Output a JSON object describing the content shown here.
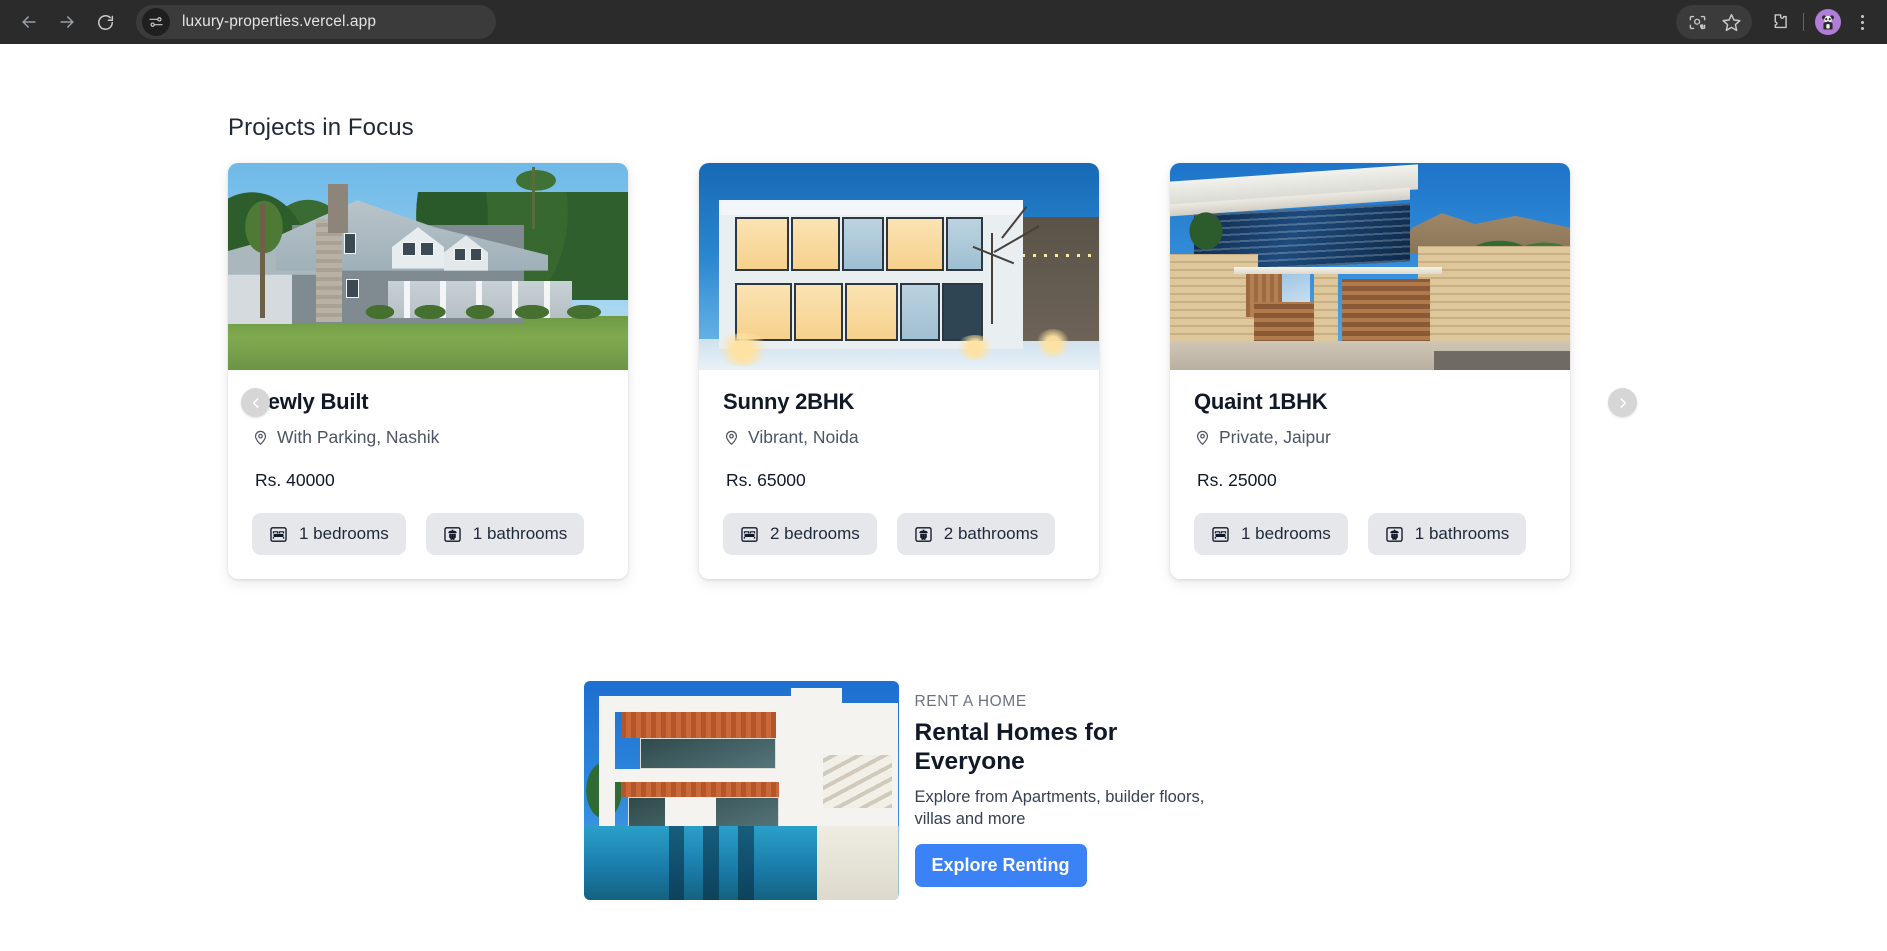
{
  "browser": {
    "url": "luxury-properties.vercel.app",
    "back_label": "Back",
    "forward_label": "Forward",
    "reload_label": "Reload",
    "site_info_label": "View site information",
    "lens_label": "Search with Google Lens",
    "bookmark_label": "Bookmark this tab",
    "extensions_label": "Extensions",
    "profile_label": "Profile",
    "menu_label": "Customize and control Google Chrome"
  },
  "page": {
    "title": "Projects in Focus"
  },
  "carousel": {
    "prev_label": "Previous",
    "next_label": "Next",
    "cards": [
      {
        "title": "Newly Built",
        "location": "With Parking, Nashik",
        "price": "Rs. 40000",
        "bedrooms": "1 bedrooms",
        "bathrooms": "1 bathrooms",
        "image_alt": "Gray craftsman house with white trim and green lawn"
      },
      {
        "title": "Sunny 2BHK",
        "location": "Vibrant, Noida",
        "price": "Rs. 65000",
        "bedrooms": "2 bedrooms",
        "bathrooms": "2 bathrooms",
        "image_alt": "Modern glass house lit at dusk in the snow"
      },
      {
        "title": "Quaint 1BHK",
        "location": "Private, Jaipur",
        "price": "Rs. 25000",
        "bedrooms": "1 bedrooms",
        "bathrooms": "1 bathrooms",
        "image_alt": "Mediterranean stone villa with wooden gates"
      }
    ]
  },
  "banner": {
    "eyebrow": "RENT A HOME",
    "heading": "Rental Homes for Everyone",
    "subtext": "Explore from Apartments, builder floors, villas and more",
    "cta_label": "Explore Renting",
    "image_alt": "Modern white villa with swimming pool",
    "cta_color": "#3b82f6"
  }
}
